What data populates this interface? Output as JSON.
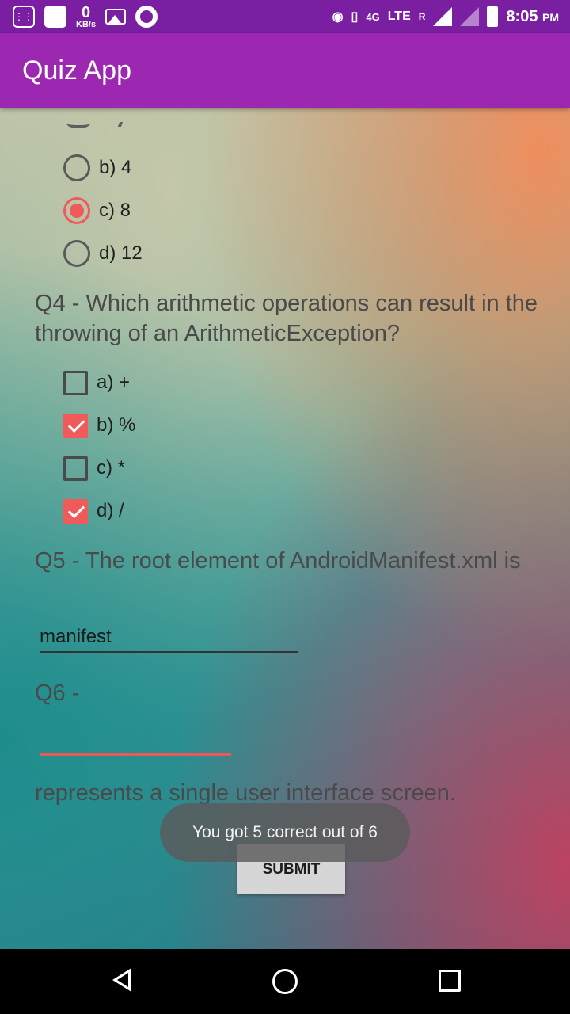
{
  "status_bar": {
    "speed_value": "0",
    "speed_unit": "KB/s",
    "network_label": "4G",
    "lte_label": "LTE",
    "roaming_label": "R",
    "time": "8:05",
    "ampm": "PM"
  },
  "app_bar": {
    "title": "Quiz App"
  },
  "q3": {
    "options": [
      {
        "label": "b) 4",
        "selected": false
      },
      {
        "label": "c) 8",
        "selected": true
      },
      {
        "label": "d) 12",
        "selected": false
      }
    ]
  },
  "q4": {
    "question": "Q4 - Which arithmetic operations can result in the throwing of an ArithmeticException?",
    "options": [
      {
        "label": "a) +",
        "checked": false
      },
      {
        "label": "b) %",
        "checked": true
      },
      {
        "label": "c) *",
        "checked": false
      },
      {
        "label": "d) /",
        "checked": true
      }
    ]
  },
  "q5": {
    "question": "Q5 - The root element of AndroidManifest.xml is",
    "answer": "manifest"
  },
  "q6": {
    "question": "Q6 -",
    "answer": "",
    "suffix": "represents a single user interface screen."
  },
  "submit_label": "SUBMIT",
  "toast": "You got 5 correct out of 6",
  "colors": {
    "status_bar": "#7b1fa2",
    "app_bar": "#9c27b0",
    "accent": "#f05a5a"
  }
}
